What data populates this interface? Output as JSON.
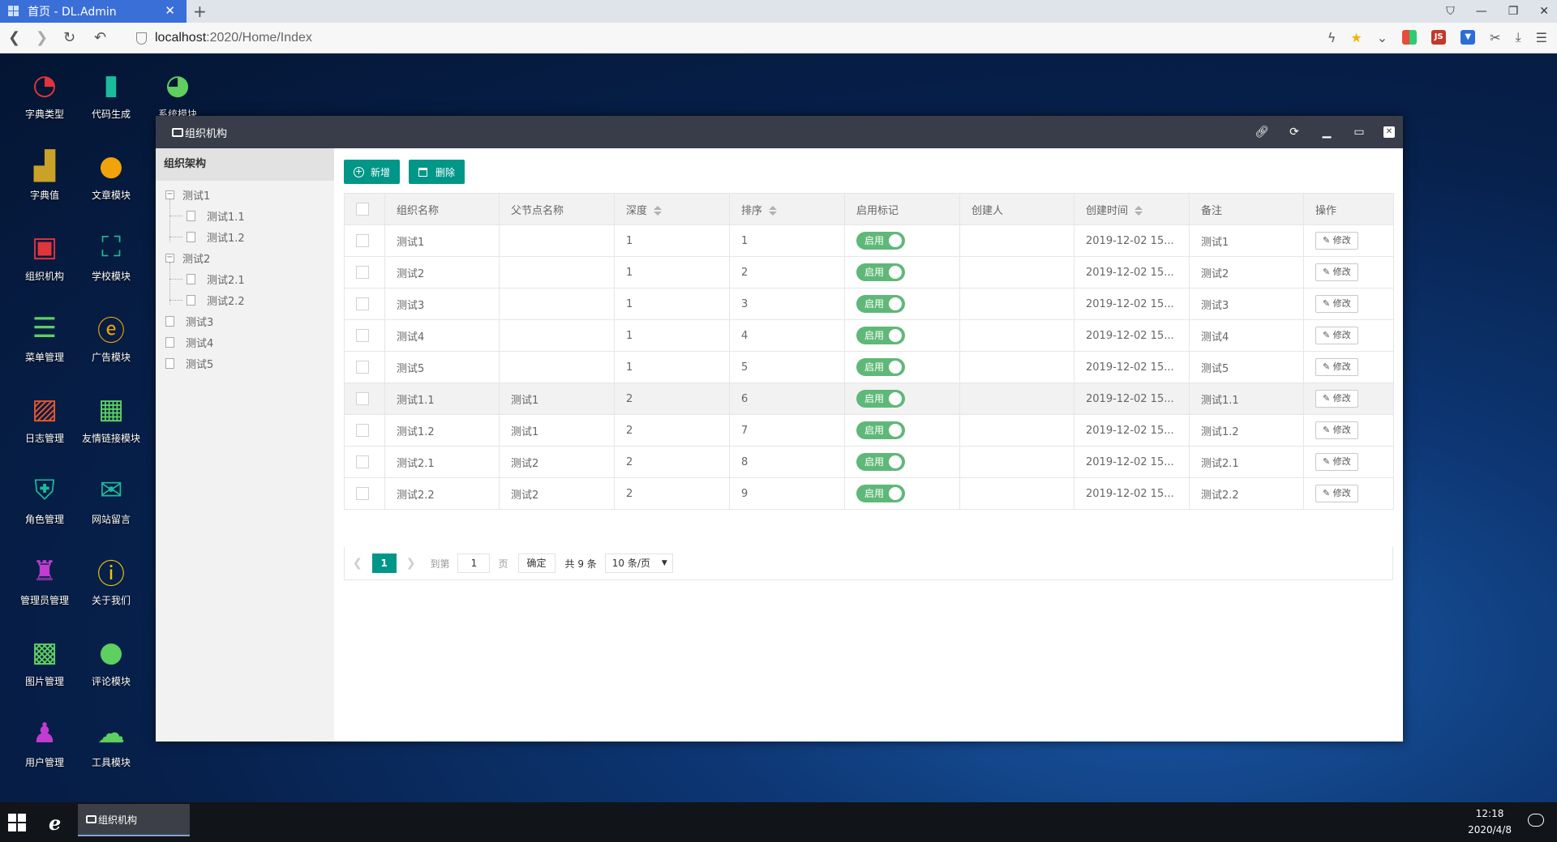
{
  "browser": {
    "tab_title": "首页 - DL.Admin",
    "url_host": "localhost",
    "url_rest": ":2020/Home/Index"
  },
  "desktop_icons": [
    {
      "label": "字典类型",
      "icon": "pie-chart-icon",
      "color": "#e0353b"
    },
    {
      "label": "代码生成",
      "icon": "book-icon",
      "color": "#1bbc9b"
    },
    {
      "label": "系统模块",
      "icon": "pie-chart-green-icon",
      "color": "#5fcf5f"
    },
    {
      "label": "字典值",
      "icon": "bar-chart-icon",
      "color": "#c9a227"
    },
    {
      "label": "文章模块",
      "icon": "apple-icon",
      "color": "#f0a30a"
    },
    {
      "label": "组织机构",
      "icon": "tv-icon",
      "color": "#e0353b"
    },
    {
      "label": "学校模块",
      "icon": "scan-icon",
      "color": "#1bbc9b"
    },
    {
      "label": "菜单管理",
      "icon": "list-icon",
      "color": "#5fcf5f"
    },
    {
      "label": "广告模块",
      "icon": "ie-icon",
      "color": "#f0a30a"
    },
    {
      "label": "日志管理",
      "icon": "chart-line-icon",
      "color": "#e8562a"
    },
    {
      "label": "友情链接模块",
      "icon": "presentation-icon",
      "color": "#5fcf5f"
    },
    {
      "label": "角色管理",
      "icon": "mask-icon",
      "color": "#1bbc9b"
    },
    {
      "label": "网站留言",
      "icon": "mail-icon",
      "color": "#1bbc9b"
    },
    {
      "label": "管理员管理",
      "icon": "spy-icon",
      "color": "#c13ccf"
    },
    {
      "label": "关于我们",
      "icon": "info-icon",
      "color": "#f0c40a"
    },
    {
      "label": "图片管理",
      "icon": "image-icon",
      "color": "#5fcf5f"
    },
    {
      "label": "评论模块",
      "icon": "chat-icon",
      "color": "#5fcf5f"
    },
    {
      "label": "用户管理",
      "icon": "user-icon",
      "color": "#c13ccf"
    },
    {
      "label": "工具模块",
      "icon": "cloud-download-icon",
      "color": "#5fcf5f"
    }
  ],
  "window": {
    "title": "组织机构",
    "tree_title": "组织架构",
    "tree": [
      {
        "label": "测试1"
      },
      {
        "label": "测试1.1"
      },
      {
        "label": "测试1.2"
      },
      {
        "label": "测试2"
      },
      {
        "label": "测试2.1"
      },
      {
        "label": "测试2.2"
      },
      {
        "label": "测试3"
      },
      {
        "label": "测试4"
      },
      {
        "label": "测试5"
      }
    ],
    "add_label": "新增",
    "delete_label": "删除",
    "columns": [
      "组织名称",
      "父节点名称",
      "深度",
      "排序",
      "启用标记",
      "创建人",
      "创建时间",
      "备注",
      "操作"
    ],
    "rows": [
      {
        "name": "测试1",
        "parent": "",
        "depth": "1",
        "order": "1",
        "enabled": "启用",
        "creator": "",
        "created": "2019-12-02 15...",
        "remark": "测试1",
        "action": "修改"
      },
      {
        "name": "测试2",
        "parent": "",
        "depth": "1",
        "order": "2",
        "enabled": "启用",
        "creator": "",
        "created": "2019-12-02 15...",
        "remark": "测试2",
        "action": "修改"
      },
      {
        "name": "测试3",
        "parent": "",
        "depth": "1",
        "order": "3",
        "enabled": "启用",
        "creator": "",
        "created": "2019-12-02 15...",
        "remark": "测试3",
        "action": "修改"
      },
      {
        "name": "测试4",
        "parent": "",
        "depth": "1",
        "order": "4",
        "enabled": "启用",
        "creator": "",
        "created": "2019-12-02 15...",
        "remark": "测试4",
        "action": "修改"
      },
      {
        "name": "测试5",
        "parent": "",
        "depth": "1",
        "order": "5",
        "enabled": "启用",
        "creator": "",
        "created": "2019-12-02 15...",
        "remark": "测试5",
        "action": "修改"
      },
      {
        "name": "测试1.1",
        "parent": "测试1",
        "depth": "2",
        "order": "6",
        "enabled": "启用",
        "creator": "",
        "created": "2019-12-02 15...",
        "remark": "测试1.1",
        "action": "修改"
      },
      {
        "name": "测试1.2",
        "parent": "测试1",
        "depth": "2",
        "order": "7",
        "enabled": "启用",
        "creator": "",
        "created": "2019-12-02 15...",
        "remark": "测试1.2",
        "action": "修改"
      },
      {
        "name": "测试2.1",
        "parent": "测试2",
        "depth": "2",
        "order": "8",
        "enabled": "启用",
        "creator": "",
        "created": "2019-12-02 15...",
        "remark": "测试2.1",
        "action": "修改"
      },
      {
        "name": "测试2.2",
        "parent": "测试2",
        "depth": "2",
        "order": "9",
        "enabled": "启用",
        "creator": "",
        "created": "2019-12-02 15...",
        "remark": "测试2.2",
        "action": "修改"
      }
    ],
    "pager": {
      "current": "1",
      "goto_label": "到第",
      "page_value": "1",
      "page_unit": "页",
      "confirm": "确定",
      "total": "共 9 条",
      "page_size": "10 条/页"
    }
  },
  "taskbar": {
    "app_label": "组织机构",
    "time": "12:18",
    "date": "2020/4/8"
  }
}
